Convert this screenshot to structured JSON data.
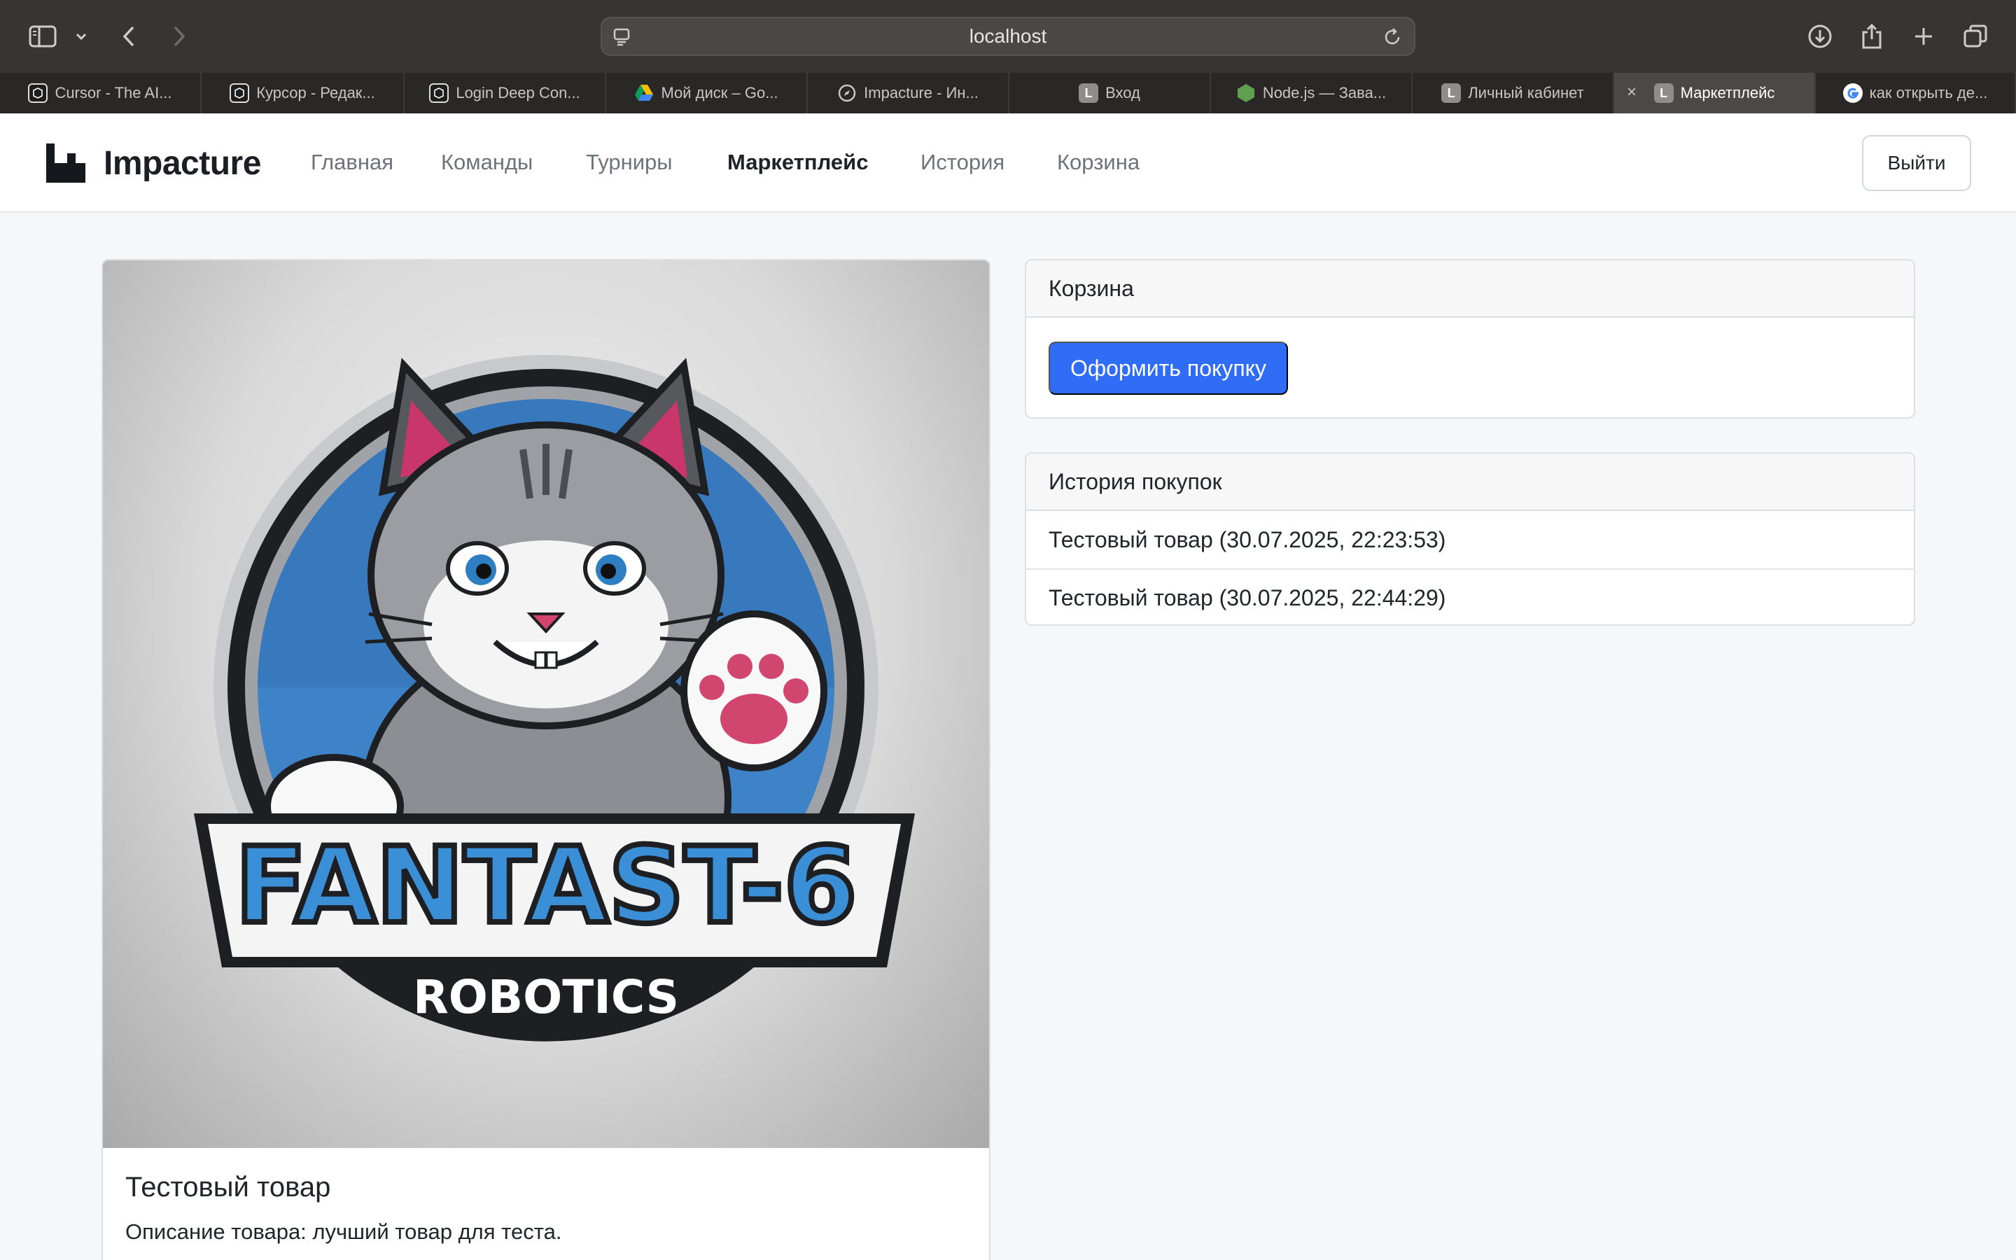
{
  "browser": {
    "url": "localhost",
    "tabs": [
      {
        "label": "Cursor - The AI...",
        "favicon": "cursor-icon"
      },
      {
        "label": "Курсор - Редак...",
        "favicon": "cursor-icon"
      },
      {
        "label": "Login Deep Con...",
        "favicon": "cursor-icon"
      },
      {
        "label": "Мой диск – Go...",
        "favicon": "google-drive-icon"
      },
      {
        "label": "Impacture - Ин...",
        "favicon": "compass-icon"
      },
      {
        "label": "Вход",
        "favicon": "L-letter-icon"
      },
      {
        "label": "Node.js — Зава...",
        "favicon": "nodejs-icon"
      },
      {
        "label": "Личный кабинет",
        "favicon": "L-letter-icon"
      },
      {
        "label": "Маркетплейс",
        "favicon": "L-letter-icon",
        "active": true
      },
      {
        "label": "как открыть де...",
        "favicon": "google-icon"
      }
    ],
    "favicon_letter": "L"
  },
  "navbar": {
    "brand": "Impacture",
    "links": [
      "Главная",
      "Команды",
      "Турниры",
      "Маркетплейс",
      "История",
      "Корзина"
    ],
    "active_link": "Маркетплейс",
    "logout_label": "Выйти"
  },
  "product": {
    "image_text_line1": "FANTAST-6",
    "image_text_line2": "ROBOTICS",
    "title": "Тестовый товар",
    "description": "Описание товара: лучший товар для теста."
  },
  "cart": {
    "header": "Корзина",
    "checkout_label": "Оформить покупку"
  },
  "history": {
    "header": "История покупок",
    "items": [
      "Тестовый товар (30.07.2025, 22:23:53)",
      "Тестовый товар (30.07.2025, 22:44:29)"
    ]
  },
  "colors": {
    "primary": "#2f6df6",
    "chrome_bg": "#373432",
    "page_bg": "#f6f7f9"
  }
}
